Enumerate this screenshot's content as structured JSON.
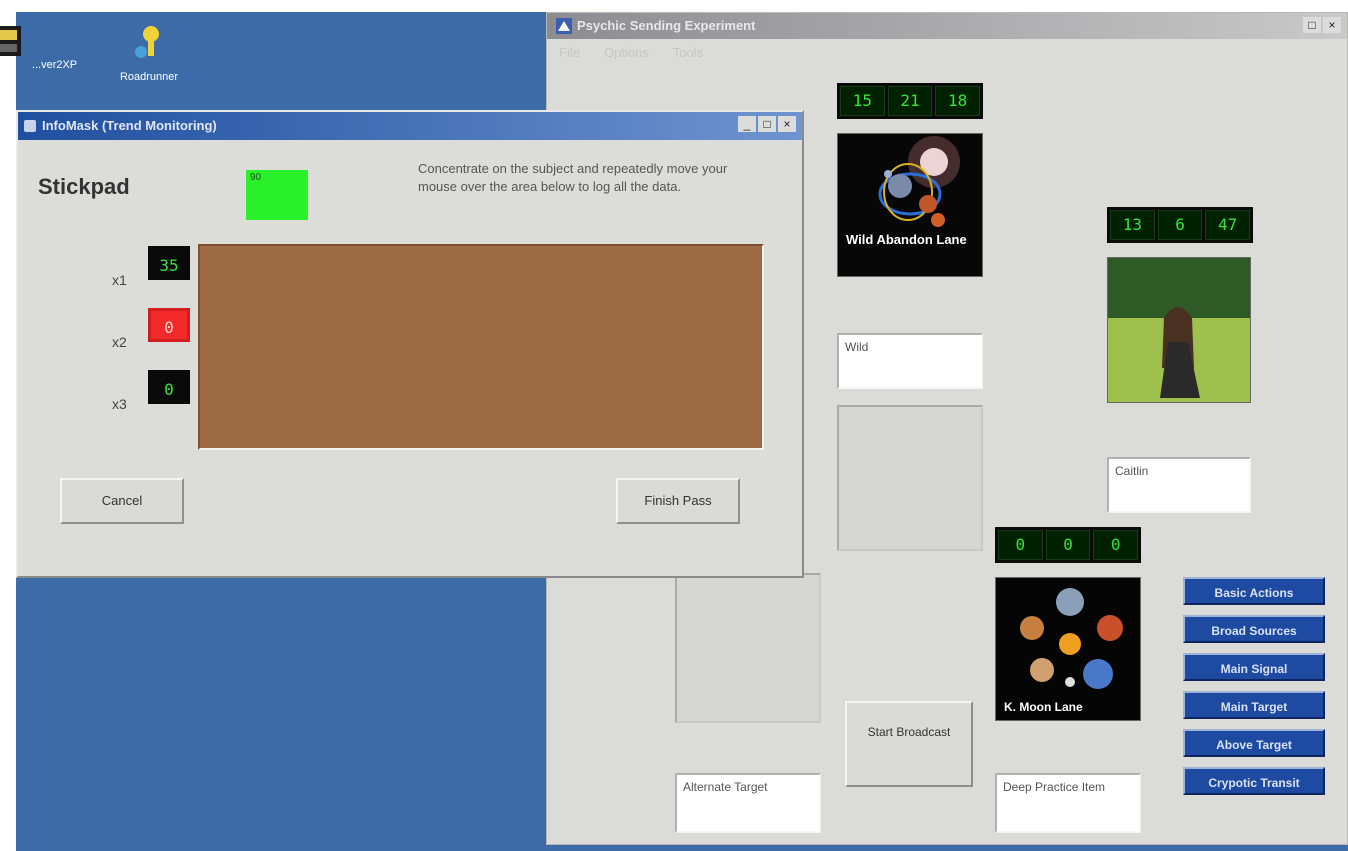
{
  "desktop": {
    "icons": [
      {
        "label": "...ver2XP",
        "icon": "application-icon"
      },
      {
        "label": "Roadrunner",
        "icon": "network-key-icon"
      }
    ]
  },
  "main_window": {
    "title": "Psychic Sending Experiment",
    "menu": [
      "File",
      "Options",
      "Tools"
    ],
    "led_top": [
      "15",
      "21",
      "18"
    ],
    "led_right": [
      "13",
      "6",
      "47"
    ],
    "led_bottom": [
      "0",
      "0",
      "0"
    ],
    "picture_captions": {
      "space": "Wild Abandon Lane",
      "planets": "K. Moon Lane"
    },
    "textboxes": {
      "center": "Wild",
      "right": "Caitlin",
      "alternate_target": "Alternate Target",
      "deep_practice": "Deep Practice Item"
    },
    "start_broadcast": "Start Broadcast",
    "blue_buttons": [
      "Basic Actions",
      "Broad Sources",
      "Main Signal",
      "Main Target",
      "Above Target",
      "Crypotic Transit"
    ],
    "colors": {
      "window_bg": "#dbdbd8",
      "button_blue": "#1e4aa1",
      "led_green": "#36e43a"
    }
  },
  "dialog": {
    "title": "InfoMask (Trend Monitoring)",
    "heading": "Stickpad",
    "status_square_text": "90",
    "instructions": "Concentrate on the subject and repeatedly move your mouse over the area below to log all the data.",
    "axes": [
      {
        "label": "x1",
        "value": "35",
        "state": "normal"
      },
      {
        "label": "x2",
        "value": "0",
        "state": "alert"
      },
      {
        "label": "x3",
        "value": "0",
        "state": "normal"
      }
    ],
    "cancel_label": "Cancel",
    "done_label": "Finish Pass",
    "colors": {
      "pad": "#9c6a43",
      "status": "#29f02a",
      "alert": "#f22a2a",
      "titlebar": "#1f4f9f"
    }
  }
}
